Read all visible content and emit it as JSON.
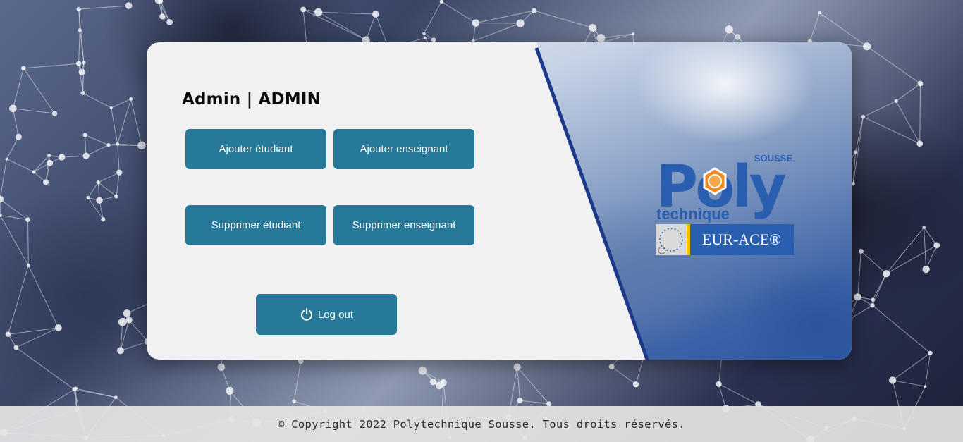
{
  "admin_panel": {
    "title": "Admin | ADMIN",
    "buttons": {
      "add_student": "Ajouter étudiant",
      "add_teacher": "Ajouter enseignant",
      "delete_student": "Supprimer étudiant",
      "delete_teacher": "Supprimer enseignant",
      "logout": "Log out"
    }
  },
  "logo": {
    "top_text": "SOUSSE",
    "brand": "Poly",
    "subtitle": "technique",
    "badge": "EUR-ACE®"
  },
  "footer": {
    "text": "© Copyright 2022 Polytechnique Sousse. Tous droits réservés."
  },
  "colors": {
    "button": "#27799a",
    "logo_blue": "#2a5fb0",
    "logo_orange": "#f28a1e",
    "stripe": "#1d3a8a"
  },
  "icons": {
    "logout": "power-icon"
  }
}
